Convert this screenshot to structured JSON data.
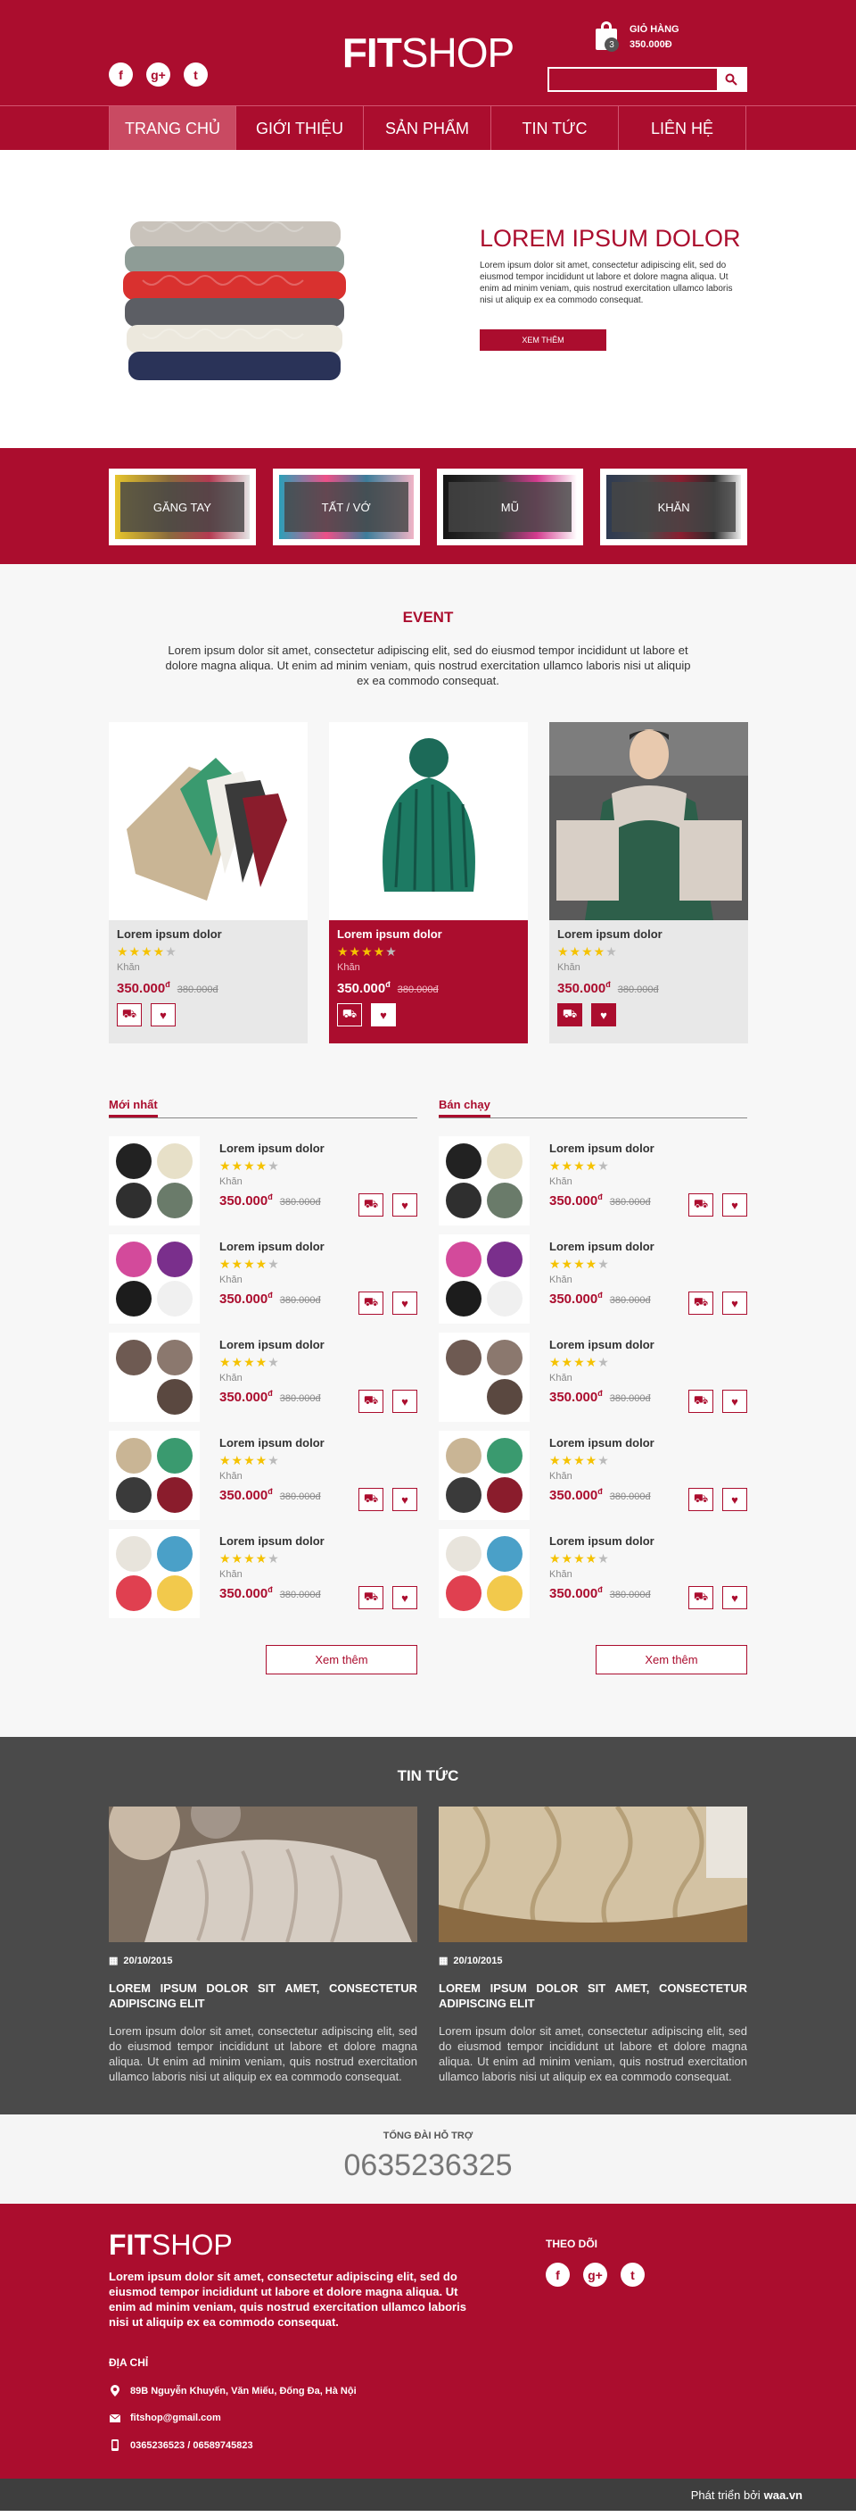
{
  "header": {
    "logo_bold": "FIT",
    "logo_rest": "SHOP",
    "cart_label": "GIỎ HÀNG",
    "cart_total": "350.000Đ",
    "cart_count": "3",
    "search_placeholder": "",
    "social": [
      "f",
      "g+",
      "t"
    ]
  },
  "nav": [
    "TRANG CHỦ",
    "GIỚI THIỆU",
    "SẢN PHẨM",
    "TIN TỨC",
    "LIÊN HỆ"
  ],
  "hero": {
    "title": "LOREM IPSUM DOLOR",
    "text": "Lorem ipsum dolor sit amet, consectetur adipiscing elit, sed do eiusmod tempor incididunt ut labore et dolore magna aliqua. Ut enim ad minim veniam, quis nostrud exercitation ullamco laboris nisi ut aliquip ex ea commodo consequat.",
    "button": "XEM THÊM"
  },
  "categories": [
    "GĂNG TAY",
    "TẤT / VỚ",
    "MŨ",
    "KHĂN"
  ],
  "event": {
    "title": "EVENT",
    "intro": "Lorem ipsum dolor sit amet, consectetur adipiscing elit, sed do eiusmod tempor incididunt ut labore et dolore magna aliqua. Ut enim ad minim veniam, quis nostrud exercitation ullamco laboris nisi ut aliquip ex ea commodo consequat.",
    "cards": [
      {
        "name": "Lorem ipsum dolor",
        "type": "Khăn",
        "price": "350.000",
        "currency": "đ",
        "old_price": "380.000đ",
        "rating": 4
      },
      {
        "name": "Lorem ipsum dolor",
        "type": "Khăn",
        "price": "350.000",
        "currency": "đ",
        "old_price": "380.000đ",
        "rating": 4
      },
      {
        "name": "Lorem ipsum dolor",
        "type": "Khăn",
        "price": "350.000",
        "currency": "đ",
        "old_price": "380.000đ",
        "rating": 4
      }
    ]
  },
  "lists": {
    "newest_title": "Mới nhất",
    "best_title": "Bán chạy",
    "more_label": "Xem thêm",
    "item": {
      "name": "Lorem ipsum dolor",
      "type": "Khăn",
      "price": "350.000",
      "currency": "đ",
      "old_price": "380.000đ",
      "rating": 4
    }
  },
  "news": {
    "title": "TIN TỨC",
    "posts": [
      {
        "date": "20/10/2015",
        "heading": "LOREM IPSUM DOLOR SIT AMET, CONSECTETUR ADIPISCING ELIT",
        "text": "Lorem ipsum dolor sit amet, consectetur adipiscing elit, sed do eiusmod tempor incididunt ut labore et dolore magna aliqua. Ut enim ad minim veniam, quis nostrud exercitation ullamco laboris nisi ut aliquip ex ea commodo consequat."
      },
      {
        "date": "20/10/2015",
        "heading": "LOREM IPSUM DOLOR SIT AMET, CONSECTETUR ADIPISCING ELIT",
        "text": "Lorem ipsum dolor sit amet, consectetur adipiscing elit, sed do eiusmod tempor incididunt ut labore et dolore magna aliqua. Ut enim ad minim veniam, quis nostrud exercitation ullamco laboris nisi ut aliquip ex ea commodo consequat."
      }
    ]
  },
  "hotline": {
    "label": "TỔNG ĐÀI HỖ TRỢ",
    "number": "0635236325"
  },
  "footer": {
    "logo_bold": "FIT",
    "logo_rest": "SHOP",
    "desc": "Lorem ipsum dolor sit amet, consectetur adipiscing elit, sed do eiusmod tempor incididunt ut labore et dolore magna aliqua. Ut enim ad minim veniam, quis nostrud exercitation ullamco laboris nisi ut aliquip ex ea commodo consequat.",
    "address_title": "ĐỊA CHỈ",
    "address": "89B Nguyễn Khuyến, Văn Miếu, Đống Đa, Hà Nội",
    "email": "fitshop@gmail.com",
    "phone": "0365236523 / 06589745823",
    "follow_title": "THEO DÕI",
    "credit_prefix": "Phát triển bởi",
    "credit_name": "waa.vn"
  },
  "colors": {
    "brand": "#ab0d2e",
    "dark": "#4a4a4a",
    "star": "#f5c200"
  }
}
